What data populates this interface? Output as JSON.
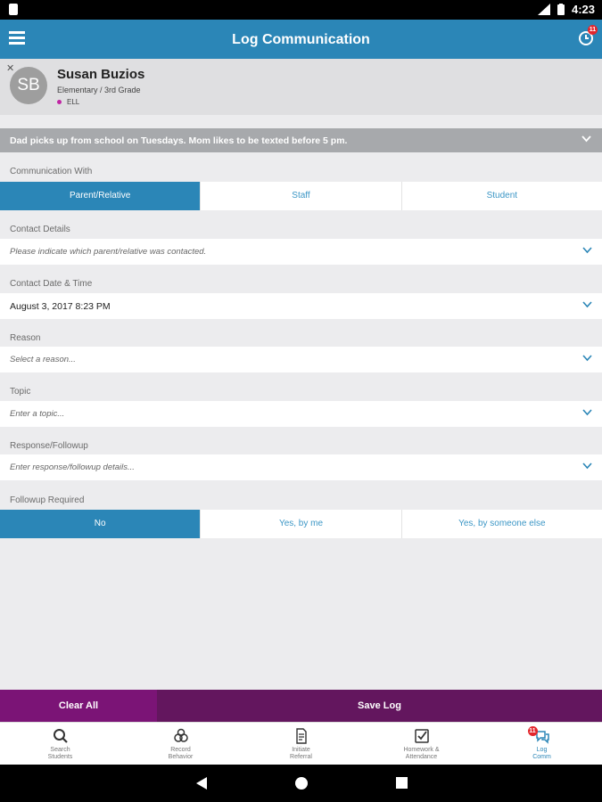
{
  "status": {
    "time": "4:23"
  },
  "appbar": {
    "title": "Log Communication",
    "timer_badge": "11"
  },
  "student": {
    "initials": "SB",
    "name": "Susan Buzios",
    "grade": "Elementary / 3rd Grade",
    "tag": "ELL"
  },
  "note": "Dad picks up from school on Tuesdays. Mom likes to be texted before 5 pm.",
  "form": {
    "communication_with": {
      "label": "Communication With",
      "options": [
        "Parent/Relative",
        "Staff",
        "Student"
      ],
      "selected": "Parent/Relative"
    },
    "contact_details": {
      "label": "Contact Details",
      "placeholder": "Please indicate which parent/relative was contacted."
    },
    "contact_datetime": {
      "label": "Contact Date & Time",
      "value": "August 3, 2017 8:23 PM"
    },
    "reason": {
      "label": "Reason",
      "placeholder": "Select a reason..."
    },
    "topic": {
      "label": "Topic",
      "placeholder": "Enter a topic..."
    },
    "response": {
      "label": "Response/Followup",
      "placeholder": "Enter response/followup details..."
    },
    "followup_required": {
      "label": "Followup Required",
      "options": [
        "No",
        "Yes, by me",
        "Yes, by someone else"
      ],
      "selected": "No"
    }
  },
  "actions": {
    "clear": "Clear All",
    "save": "Save Log"
  },
  "tabs": [
    {
      "label1": "Search",
      "label2": "Students",
      "icon": "search-icon"
    },
    {
      "label1": "Record",
      "label2": "Behavior",
      "icon": "behavior-icon"
    },
    {
      "label1": "Initiate",
      "label2": "Referral",
      "icon": "referral-icon"
    },
    {
      "label1": "Homework &",
      "label2": "Attendance",
      "icon": "checklist-icon"
    },
    {
      "label1": "Log",
      "label2": "Comm",
      "icon": "chat-icon",
      "badge": "11"
    }
  ],
  "colors": {
    "primary": "#2b86b7",
    "accent_purple": "#63165e",
    "clear_purple": "#7b1476",
    "badge_red": "#e3262c",
    "tag_dot": "#c025a4"
  }
}
